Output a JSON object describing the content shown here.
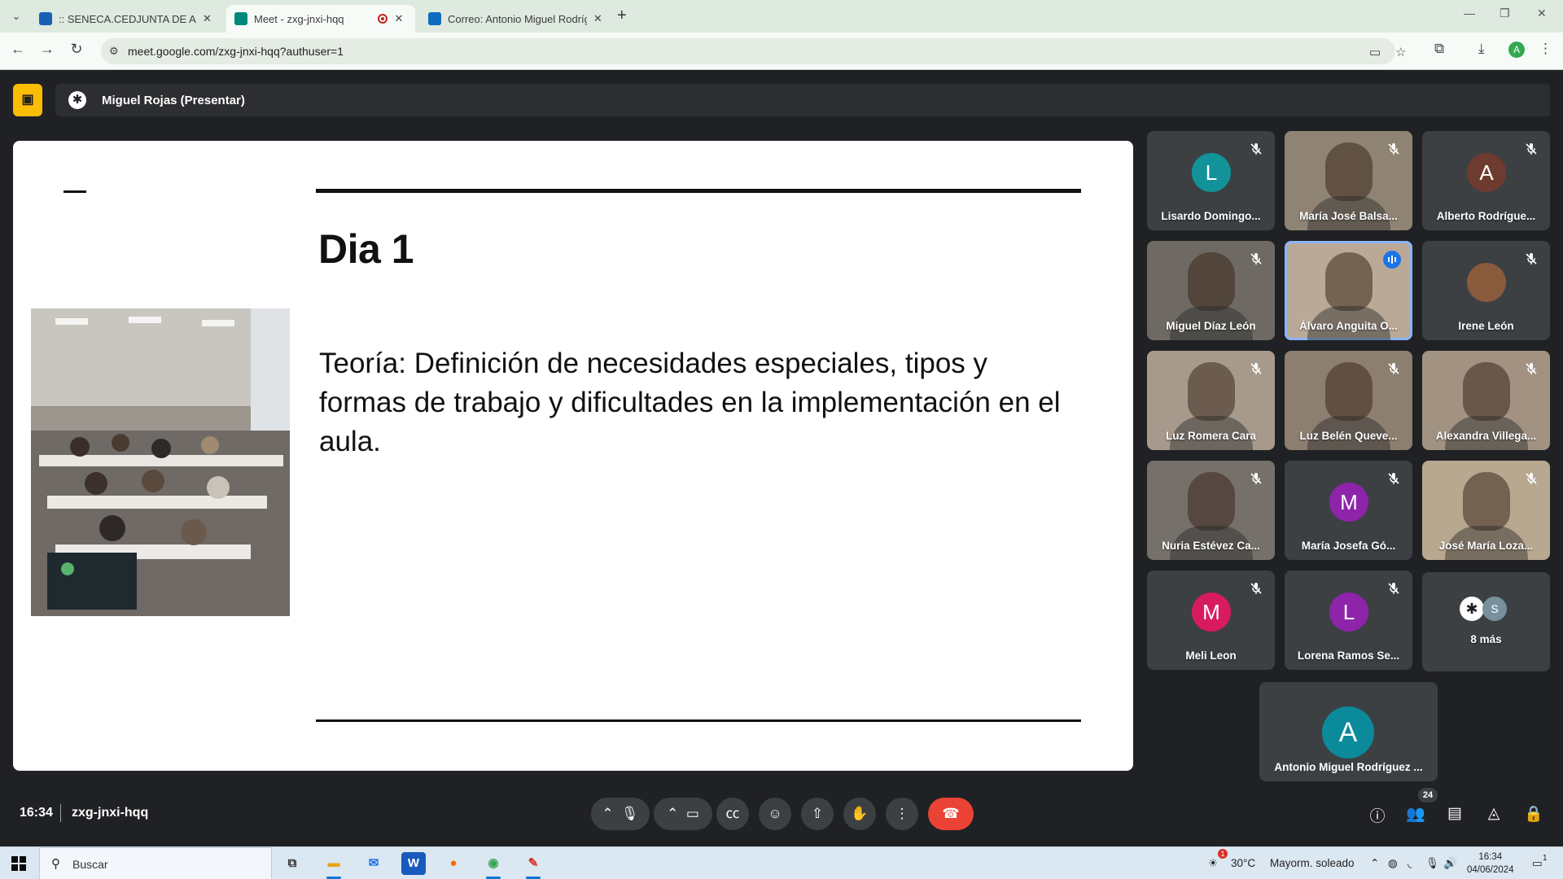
{
  "browser": {
    "tabs": [
      {
        "title": ":: SENECA.CEDJUNTA DE ANDALUCÍA ::",
        "active": false,
        "favicon_color": "#1a5fb4"
      },
      {
        "title": "Meet - zxg-jnxi-hqq",
        "active": true,
        "favicon_color": "#00897b"
      },
      {
        "title": "Correo: Antonio Miguel Rodríguez",
        "active": false,
        "favicon_color": "#0f6cbd"
      }
    ],
    "url": "meet.google.com/zxg-jnxi-hqq?authuser=1",
    "profile_initial": "A"
  },
  "meet": {
    "presenter_label": "Miguel Rojas (Presentar)",
    "slide": {
      "title": "Dia 1",
      "body": "Teoría: Definición de necesidades especiales, tipos y formas de trabajo y dificultades en la implementación en el aula."
    },
    "participants": [
      {
        "name": "Lisardo Domingo...",
        "initial": "L",
        "avatar_color": "#12939a",
        "video": false,
        "muted": true,
        "speaking": false
      },
      {
        "name": "María José Balsa...",
        "initial": "",
        "avatar_color": "",
        "video": true,
        "muted": true,
        "speaking": false
      },
      {
        "name": "Alberto Rodrígue...",
        "initial": "A",
        "avatar_color": "#6d3c2e",
        "video": false,
        "muted": true,
        "speaking": false
      },
      {
        "name": "Miguel Díaz León",
        "initial": "",
        "avatar_color": "",
        "video": true,
        "muted": true,
        "speaking": false
      },
      {
        "name": "Álvaro Anguita O...",
        "initial": "",
        "avatar_color": "",
        "video": true,
        "muted": false,
        "speaking": true
      },
      {
        "name": "Irene León",
        "initial": "",
        "avatar_color": "#8a5a3c",
        "video": false,
        "muted": true,
        "speaking": false
      },
      {
        "name": "Luz Romera Cara",
        "initial": "",
        "avatar_color": "",
        "video": true,
        "muted": true,
        "speaking": false
      },
      {
        "name": "Luz Belén Queve...",
        "initial": "",
        "avatar_color": "",
        "video": true,
        "muted": true,
        "speaking": false
      },
      {
        "name": "Alexandra Villega...",
        "initial": "",
        "avatar_color": "",
        "video": true,
        "muted": true,
        "speaking": false
      },
      {
        "name": "Nuria Estévez Ca...",
        "initial": "",
        "avatar_color": "",
        "video": true,
        "muted": true,
        "speaking": false
      },
      {
        "name": "María Josefa Gó...",
        "initial": "M",
        "avatar_color": "#8e24aa",
        "video": false,
        "muted": true,
        "speaking": false
      },
      {
        "name": "José María Loza...",
        "initial": "",
        "avatar_color": "",
        "video": true,
        "muted": true,
        "speaking": false
      },
      {
        "name": "Meli Leon",
        "initial": "M",
        "avatar_color": "#d81b60",
        "video": false,
        "muted": true,
        "speaking": false
      },
      {
        "name": "Lorena Ramos Se...",
        "initial": "L",
        "avatar_color": "#8e24aa",
        "video": false,
        "muted": true,
        "speaking": false
      }
    ],
    "more": {
      "label": "8 más",
      "initial": "S"
    },
    "self": {
      "name": "Antonio Miguel Rodríguez ...",
      "initial": "A"
    },
    "time": "16:34",
    "meeting_code": "zxg-jnxi-hqq",
    "people_count": "24"
  },
  "taskbar": {
    "search_placeholder": "Buscar",
    "weather_temp": "30°C",
    "weather_text": "Mayorm. soleado",
    "clock_time": "16:34",
    "clock_date": "04/06/2024",
    "notification_count": "1",
    "action_center_count": "1"
  }
}
